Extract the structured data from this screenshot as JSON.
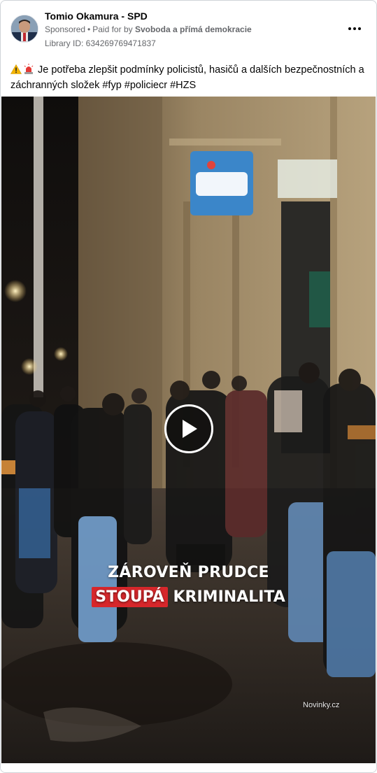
{
  "post": {
    "page_name": "Tomio Okamura - SPD",
    "sponsored_label": "Sponsored",
    "paid_for_prefix": "Paid for by",
    "paid_for_by": "Svoboda a přímá demokracie",
    "library_id": "Library ID: 634269769471837",
    "more_icon": "more-options-icon",
    "text": "Je potřeba zlepšit podmínky policistů, hasičů a dalších bezpečnostních a záchranných složek #fyp #policiecr #HZS",
    "emojis": [
      "warning-icon",
      "police-light-icon"
    ]
  },
  "video": {
    "caption_line1": "ZÁROVEŇ PRUDCE",
    "caption_highlight": "STOUPÁ",
    "caption_rest": "KRIMINALITA",
    "watermark": "Novinky.cz",
    "play_icon": "play-icon",
    "highlight_color": "#d7272b"
  }
}
